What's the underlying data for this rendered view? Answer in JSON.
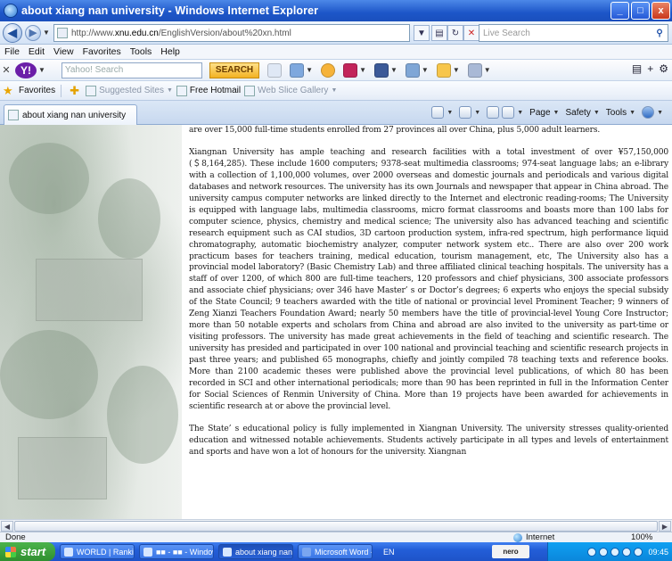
{
  "window": {
    "title": "about xiang nan university - Windows Internet Explorer",
    "min": "_",
    "max": "□",
    "close": "x"
  },
  "address": {
    "url_prefix": "http://www.",
    "url_domain": "xnu.edu.cn",
    "url_rest": "/EnglishVersion/about%20xn.html",
    "search_placeholder": "Live Search"
  },
  "menu": [
    "File",
    "Edit",
    "View",
    "Favorites",
    "Tools",
    "Help"
  ],
  "yahoo_toolbar": {
    "search_placeholder": "Yahoo! Search",
    "search_button": "SEARCH"
  },
  "favorites_bar": {
    "favorites_label": "Favorites",
    "suggested_sites": "Suggested Sites",
    "free_hotmail": "Free Hotmail",
    "web_slice_gallery": "Web Slice Gallery"
  },
  "tab": {
    "label": "about xiang nan university"
  },
  "commandbar": {
    "page": "Page",
    "safety": "Safety",
    "tools": "Tools"
  },
  "article": {
    "paragraphs": [
      "are over 15,000 full-time students enrolled from 27 provinces all over China, plus 5,000 adult learners.",
      "Xiangnan University has ample teaching and research facilities with a total investment of over ¥57,150,000 (＄8,164,285). These include 1600 computers; 9378-seat multimedia classrooms; 974-seat language labs; an e-library with a collection of 1,100,000 volumes, over 2000 overseas and domestic journals and periodicals and various digital databases and network resources. The university has its own Journals and newspaper that appear in China abroad. The university campus computer networks are linked directly to the Internet and electronic reading-rooms; The University is equipped with language labs, multimedia classrooms, micro format classrooms and boasts more than 100 labs for computer science, physics, chemistry and medical science; The university also has advanced teaching and scientific research equipment such as CAI studios, 3D cartoon production system, infra-red spectrum, high performance liquid chromatography, automatic biochemistry analyzer, computer network system etc.. There are also over 200 work practicum bases for teachers training, medical education, tourism management, etc, The University also has a provincial model laboratory? (Basic Chemistry Lab) and three affiliated clinical teaching hospitals.    The university has a staff of over 1200, of which 800 are full-time teachers, 120 professors and chief physicians, 300 associate professors and associate chief physicians; over 346 have Master’ s or Doctor’s degrees; 6 experts who enjoys the special subsidy of the State Council; 9 teachers awarded with the title of national or provincial level Prominent Teacher; 9 winners of Zeng Xianzi Teachers Foundation Award; nearly 50 members have the title of provincial-level Young Core Instructor; more than 50 notable experts and scholars from China and abroad are also invited to the university as part-time or visiting professors. The university has made great achievements in the field of teaching and scientific research. The university has presided and participated in over 100 national and provincial teaching and scientific research projects in past three years; and published 65 monographs, chiefly and jointly compiled 78 teaching texts and reference books. More than 2100 academic theses were published above the provincial level publications, of which 80 has been recorded in SCI and other international periodicals; more than 90 has been reprinted in full in the Information Center for Social Sciences of Renmin University of China. More than 19 projects have been awarded for achievements in scientific research at or above the provincial level.",
      "The State’ s educational policy is fully implemented in Xiangnan University. The university stresses quality-oriented education and witnessed notable achievements. Students actively participate in all types and levels of entertainment and sports and have won a lot of honours for the university. Xiangnan"
    ]
  },
  "statusbar": {
    "left": "Done",
    "zone": "Internet",
    "zoom": "100%"
  },
  "taskbar": {
    "start": "start",
    "tasks": [
      "WORLD | Rankin...",
      "■■ - ■■ - Window...",
      "about xiang nan ...",
      "Microsoft Word - ..."
    ],
    "lang": "EN",
    "nero": "nero",
    "clock": "09:45"
  }
}
